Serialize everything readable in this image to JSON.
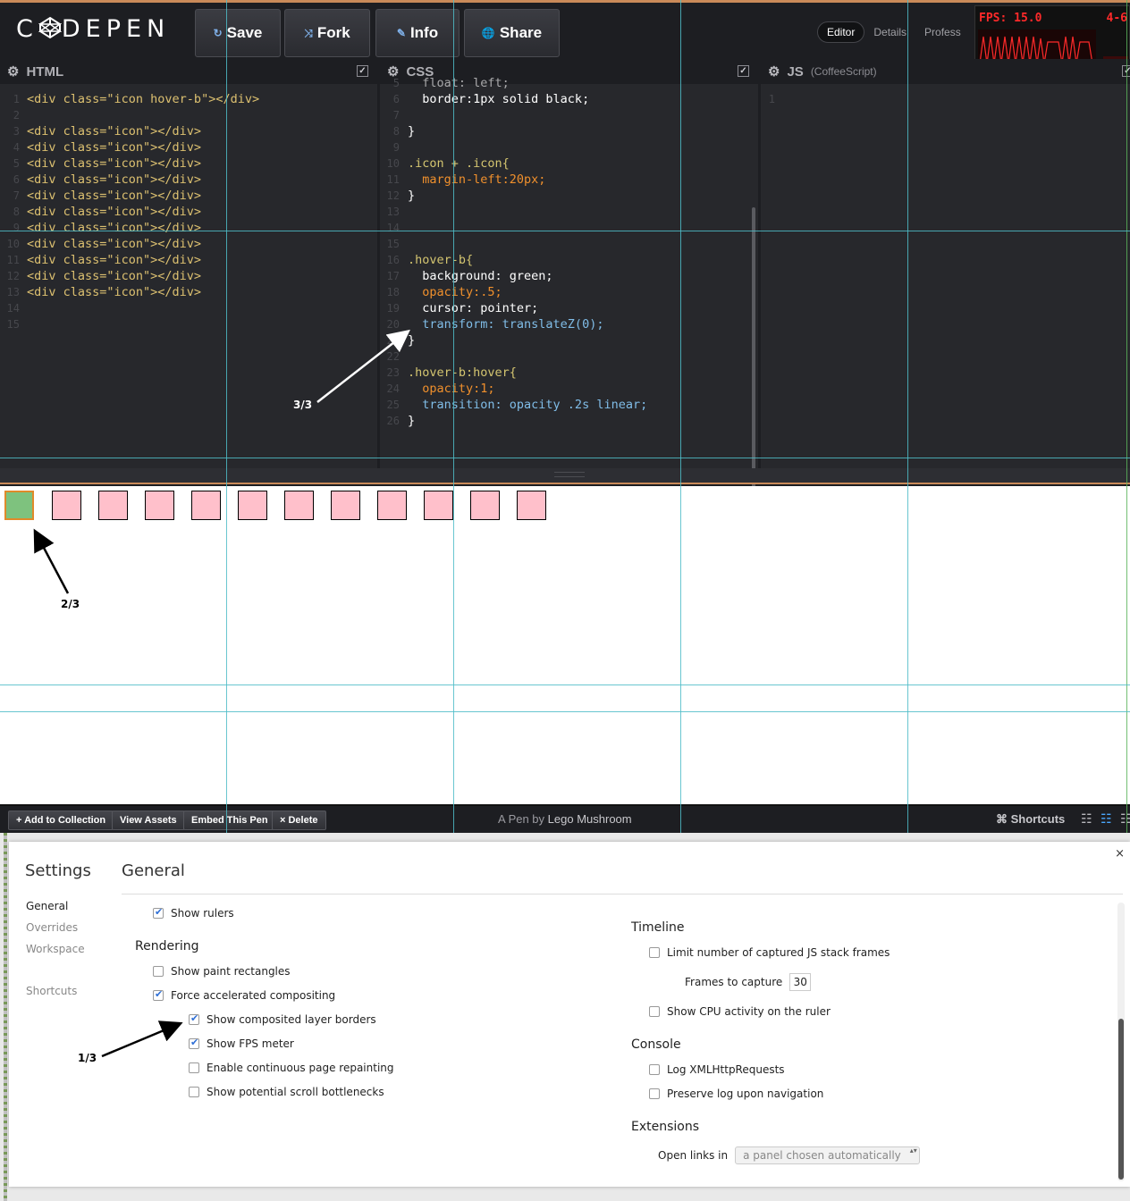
{
  "header": {
    "logo": "C DEPEN",
    "buttons": {
      "save": "Save",
      "fork": "Fork",
      "info": "Info",
      "share": "Share"
    },
    "view_tabs": [
      "Editor",
      "Details",
      "Profess"
    ],
    "fps": {
      "label": "FPS: 15.0",
      "range": "4-6"
    }
  },
  "editors": {
    "html": {
      "title": "HTML",
      "line_numbers": [
        "1",
        "2",
        "3",
        "4",
        "5",
        "6",
        "7",
        "8",
        "9",
        "10",
        "11",
        "12",
        "13",
        "14",
        "15"
      ],
      "lines": [
        "<div class=\"icon hover-b\"></div>",
        "",
        "<div class=\"icon\"></div>",
        "<div class=\"icon\"></div>",
        "<div class=\"icon\"></div>",
        "<div class=\"icon\"></div>",
        "<div class=\"icon\"></div>",
        "<div class=\"icon\"></div>",
        "<div class=\"icon\"></div>",
        "<div class=\"icon\"></div>",
        "<div class=\"icon\"></div>",
        "<div class=\"icon\"></div>",
        "<div class=\"icon\"></div>",
        "",
        ""
      ]
    },
    "css": {
      "title": "CSS",
      "line_numbers": [
        "5",
        "6",
        "7",
        "8",
        "9",
        "10",
        "11",
        "12",
        "13",
        "14",
        "15",
        "16",
        "17",
        "18",
        "19",
        "20",
        "21",
        "22",
        "23",
        "24",
        "25",
        "26"
      ],
      "lines": [
        "  float: left;",
        "  border:1px solid black;",
        "",
        "}",
        "",
        ".icon + .icon{",
        "  margin-left:20px;",
        "}",
        "",
        "",
        "",
        ".hover-b{",
        "  background: green;",
        "  opacity:.5;",
        "  cursor: pointer;",
        "  transform: translateZ(0);",
        "}",
        "",
        ".hover-b:hover{",
        "  opacity:1;",
        "  transition: opacity .2s linear;",
        "}"
      ]
    },
    "js": {
      "title": "JS",
      "subtitle": "(CoffeeScript)",
      "line_numbers": [
        "1"
      ]
    }
  },
  "footer": {
    "buttons": [
      "+ Add to Collection",
      "View Assets",
      "Embed This Pen",
      "× Delete"
    ],
    "credit_prefix": "A Pen by",
    "author": "Lego Mushroom",
    "shortcuts": "⌘ Shortcuts"
  },
  "settings": {
    "title": "Settings",
    "section_title": "General",
    "close": "×",
    "nav": [
      "General",
      "Overrides",
      "Workspace",
      "Shortcuts"
    ],
    "show_rulers": "Show rulers",
    "rendering": {
      "heading": "Rendering",
      "options": [
        {
          "label": "Show paint rectangles",
          "checked": false
        },
        {
          "label": "Force accelerated compositing",
          "checked": true
        },
        {
          "label": "Show composited layer borders",
          "checked": true
        },
        {
          "label": "Show FPS meter",
          "checked": true
        },
        {
          "label": "Enable continuous page repainting",
          "checked": false
        },
        {
          "label": "Show potential scroll bottlenecks",
          "checked": false
        }
      ]
    },
    "timeline": {
      "heading": "Timeline",
      "limit_frames": "Limit number of captured JS stack frames",
      "frames_label": "Frames to capture",
      "frames_value": "30",
      "cpu": "Show CPU activity on the ruler"
    },
    "console": {
      "heading": "Console",
      "log_xhr": "Log XMLHttpRequests",
      "preserve_log": "Preserve log upon navigation"
    },
    "extensions": {
      "heading": "Extensions",
      "open_links_label": "Open links in",
      "open_links_value": "a panel chosen automatically"
    }
  },
  "annotations": {
    "step1": "1/3",
    "step2": "2/3",
    "step3": "3/3"
  },
  "colors": {
    "accent": "#c98a59",
    "guide": "#4fbcc8",
    "icon_pink": "#ffc0cb",
    "icon_green": "#7ec27e",
    "fps_red": "#ff2a2a"
  }
}
